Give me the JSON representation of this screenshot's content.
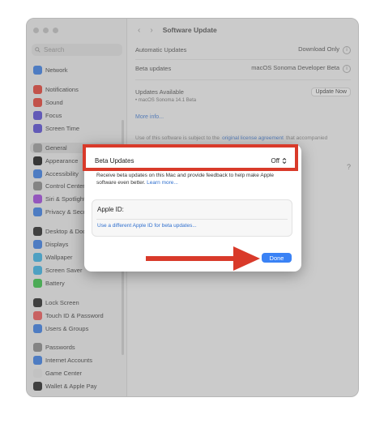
{
  "sidebar": {
    "search_placeholder": "Search",
    "items": [
      {
        "label": "Network",
        "color": "#3f7fe0"
      },
      {
        "label": "Notifications",
        "color": "#e0443a"
      },
      {
        "label": "Sound",
        "color": "#e0443a"
      },
      {
        "label": "Focus",
        "color": "#5b4fd0"
      },
      {
        "label": "Screen Time",
        "color": "#5b4fd0"
      },
      {
        "label": "General",
        "color": "#9a9a9a"
      },
      {
        "label": "Appearance",
        "color": "#1e1e1e"
      },
      {
        "label": "Accessibility",
        "color": "#3f7fe0"
      },
      {
        "label": "Control Center",
        "color": "#8a8a8a"
      },
      {
        "label": "Siri & Spotlight",
        "color": "#a04ad8"
      },
      {
        "label": "Privacy & Security",
        "color": "#3f7fe0"
      },
      {
        "label": "Desktop & Dock",
        "color": "#2b2b2b"
      },
      {
        "label": "Displays",
        "color": "#3f7fe0"
      },
      {
        "label": "Wallpaper",
        "color": "#3fb0e0"
      },
      {
        "label": "Screen Saver",
        "color": "#3fb0e0"
      },
      {
        "label": "Battery",
        "color": "#3cbf4a"
      },
      {
        "label": "Lock Screen",
        "color": "#2b2b2b"
      },
      {
        "label": "Touch ID & Password",
        "color": "#e85a5a"
      },
      {
        "label": "Users & Groups",
        "color": "#3f7fe0"
      },
      {
        "label": "Passwords",
        "color": "#8a8a8a"
      },
      {
        "label": "Internet Accounts",
        "color": "#3f7fe0"
      },
      {
        "label": "Game Center",
        "color": "#e0e0e0"
      },
      {
        "label": "Wallet & Apple Pay",
        "color": "#2b2b2b"
      }
    ]
  },
  "header": {
    "title": "Software Update"
  },
  "main": {
    "automatic_updates_label": "Automatic Updates",
    "automatic_updates_value": "Download Only",
    "beta_updates_label": "Beta updates",
    "beta_updates_value": "macOS Sonoma Developer Beta",
    "updates_available_label": "Updates Available",
    "updates_item": "• macOS Sonoma 14.1 Beta",
    "update_now_label": "Update Now",
    "more_info_label": "More info...",
    "license_prefix": "Use of this software is subject to the",
    "license_link": "original license agreement",
    "license_suffix": "that accompanied"
  },
  "dialog": {
    "beta_updates_label": "Beta Updates",
    "beta_updates_value": "Off",
    "description": "Receive beta updates on this Mac and provide feedback to help make Apple software even better.",
    "learn_more": "Learn more...",
    "apple_id_label": "Apple ID:",
    "apple_id_link": "Use a different Apple ID for beta updates...",
    "done_label": "Done"
  },
  "colors": {
    "accent": "#3a82f5",
    "annotation_red": "#d93a2a"
  }
}
